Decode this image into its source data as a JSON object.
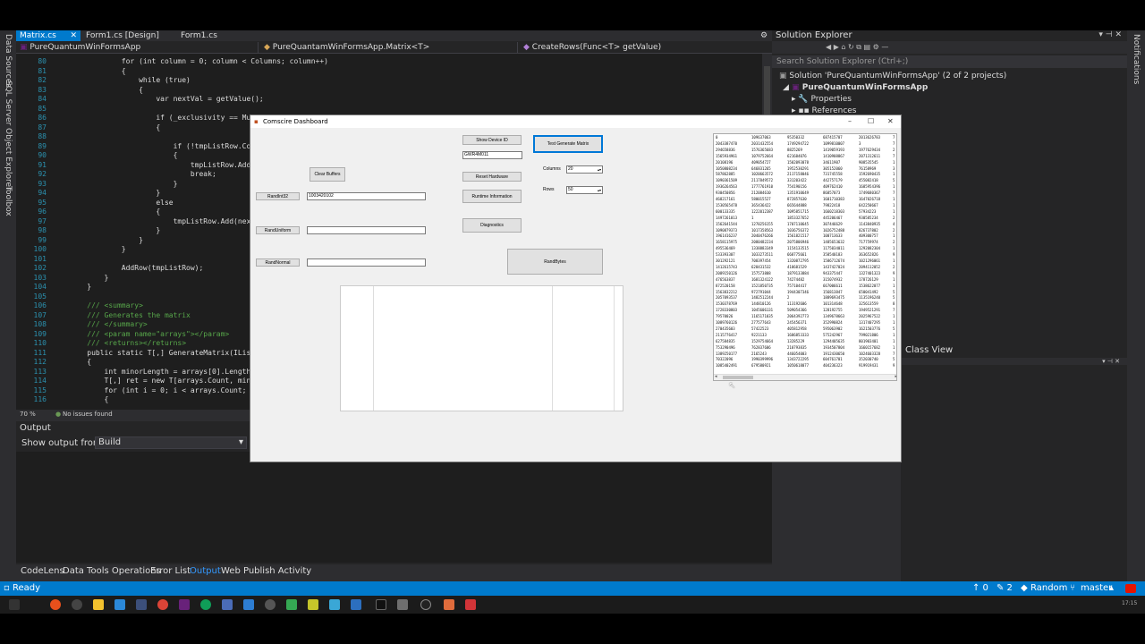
{
  "editor": {
    "tabs": [
      "Matrix.cs",
      "Form1.cs [Design]",
      "Form1.cs"
    ],
    "nav": {
      "project": "PureQuantumWinFormsApp",
      "class": "PureQuantamWinFormsApp.Matrix<T>",
      "member": "CreateRows(Func<T> getValue)"
    },
    "lines": [
      {
        "n": "80",
        "code": "            for (int column = 0; column < Columns; column++)"
      },
      {
        "n": "81",
        "code": "            {"
      },
      {
        "n": "82",
        "code": "                while (true)"
      },
      {
        "n": "83",
        "code": "                {"
      },
      {
        "n": "84",
        "code": "                    var nextVal = getValue();"
      },
      {
        "n": "85",
        "code": ""
      },
      {
        "n": "86",
        "code": "                    if (_exclusivity == Mutu"
      },
      {
        "n": "87",
        "code": "                    {"
      },
      {
        "n": "88",
        "code": ""
      },
      {
        "n": "89",
        "code": "                        if (!tmpListRow.Con"
      },
      {
        "n": "90",
        "code": "                        {"
      },
      {
        "n": "91",
        "code": "                            tmpListRow.Add("
      },
      {
        "n": "92",
        "code": "                            break;"
      },
      {
        "n": "93",
        "code": "                        }"
      },
      {
        "n": "94",
        "code": "                    }"
      },
      {
        "n": "95",
        "code": "                    else"
      },
      {
        "n": "96",
        "code": "                    {"
      },
      {
        "n": "97",
        "code": "                        tmpListRow.Add(next"
      },
      {
        "n": "98",
        "code": "                    }"
      },
      {
        "n": "99",
        "code": "                }"
      },
      {
        "n": "100",
        "code": "            }"
      },
      {
        "n": "101",
        "code": ""
      },
      {
        "n": "102",
        "code": "            AddRow(tmpListRow);"
      },
      {
        "n": "103",
        "code": "        }"
      },
      {
        "n": "104",
        "code": "    }"
      },
      {
        "n": "105",
        "code": ""
      },
      {
        "n": "106",
        "code": "    /// <summary>"
      },
      {
        "n": "107",
        "code": "    /// Generates the matrix"
      },
      {
        "n": "108",
        "code": "    /// </summary>"
      },
      {
        "n": "109",
        "code": "    /// <param name=\"arrays\"></param>"
      },
      {
        "n": "110",
        "code": "    /// <returns></returns>"
      },
      {
        "n": "111",
        "code": "    public static T[,] GenerateMatrix(IList"
      },
      {
        "n": "112",
        "code": "    {"
      },
      {
        "n": "113",
        "code": "        int minorLength = arrays[0].Length;"
      },
      {
        "n": "114",
        "code": "        T[,] ret = new T[arrays.Count, mino"
      },
      {
        "n": "115",
        "code": "        for (int i = 0; i < arrays.Count; i"
      },
      {
        "n": "116",
        "code": "        {"
      }
    ],
    "zoom": "70 %",
    "issues": "No issues found"
  },
  "left_strip": [
    "Data Sources",
    "SQL Server Object Explorer",
    "Toolbox"
  ],
  "right_strip": [
    "Notifications"
  ],
  "output": {
    "title": "Output",
    "from_label": "Show output from:",
    "from_value": "Build"
  },
  "bottom_tabs": [
    "CodeLens",
    "Data Tools Operations",
    "Error List",
    "Output",
    "Web Publish Activity"
  ],
  "solution_explorer": {
    "title": "Solution Explorer",
    "search_placeholder": "Search Solution Explorer (Ctrl+;)",
    "solution": "Solution 'PureQuantumWinFormsApp' (2 of 2 projects)",
    "project": "PureQuantumWinFormsApp",
    "properties": "Properties",
    "references": "References"
  },
  "class_view": {
    "title": "Class View"
  },
  "status": {
    "ready": "Ready",
    "up": "↑ 0",
    "pencil": "✎ 2",
    "branch_repo": "Random",
    "branch": "master",
    "time": "17:15"
  },
  "form": {
    "title": "Comscire Dashboard",
    "buttons": {
      "clear_buffers": "Clear Buffers",
      "randint32": "RandInt32",
      "rand_uniform": "RandUniform",
      "rand_normal": "RandNormal",
      "show_device_id": "Show Device ID",
      "reset_hardware": "Reset Hardware",
      "runtime_information": "Runtime Information",
      "diagnostics": "Diagnostics",
      "test_generate_matrix": "Test Generate Matrix",
      "rand_bytes": "RandBytes"
    },
    "fields": {
      "randint32_value": "1003420102",
      "device_id": "GWR4M011"
    },
    "columns_label": "Columns",
    "columns_value": "20",
    "rows_label": "Rows",
    "rows_value": "50",
    "grid_rows": [
      [
        "0",
        "109637063",
        "95350332",
        "687415707",
        "2013626783",
        "7"
      ],
      [
        "2043387470",
        "2031432554",
        "1749294722",
        "1099810007",
        "3",
        "7"
      ],
      [
        "294658836",
        "1576365683",
        "8825269",
        "1419059193",
        "1977629434",
        "2"
      ],
      [
        "1565934961",
        "1079752664",
        "621684076",
        "1410908867",
        "2071312611",
        "7"
      ],
      [
        "20108196",
        "409054727",
        "1502093078",
        "34611907",
        "908535545",
        "1"
      ],
      [
        "1050808234",
        "646831265",
        "1952530291",
        "305152060",
        "76158969",
        "3"
      ],
      [
        "587862885",
        "1020663572",
        "2117158046",
        "731745558",
        "1592690435",
        "1"
      ],
      [
        "1090361509",
        "2117849572",
        "331203422",
        "442757179",
        "455082418",
        "5"
      ],
      [
        "1936264563",
        "1777761910",
        "754190156",
        "409762410",
        "1685954396",
        "1"
      ],
      [
        "930450856",
        "212084610",
        "1351910649",
        "86857073",
        "1749680367",
        "7"
      ],
      [
        "468217161",
        "580015527",
        "872857630",
        "1601710383",
        "1647026718",
        "1"
      ],
      [
        "1530565478",
        "365436422",
        "665644888",
        "79822418",
        "642250667",
        "1"
      ],
      [
        "600133335",
        "1222012387",
        "1095851715",
        "1660218303",
        "57934223",
        "1"
      ],
      [
        "1497261013",
        "1",
        "1853327652",
        "445206467",
        "930585234",
        "2"
      ],
      [
        "1562641544",
        "1270256155",
        "1707110645",
        "307446629",
        "1143840935",
        "4"
      ],
      [
        "1090879373",
        "1017358563",
        "1036756372",
        "1026752488",
        "826737802",
        "2"
      ],
      [
        "1961416237",
        "2040476266",
        "1561821517",
        "100713633",
        "409300757",
        "1"
      ],
      [
        "1658115975",
        "2080482234",
        "2075806946",
        "1485653632",
        "717759974",
        "2"
      ],
      [
        "495536469",
        "1338883349",
        "1154133515",
        "1175034011",
        "1292082304",
        "1"
      ],
      [
        "533393307",
        "1033273511",
        "668775661",
        "358540183",
        "363652826",
        "9"
      ],
      [
        "301292121",
        "708397454",
        "1320872795",
        "1586712674",
        "1021296061",
        "1"
      ],
      [
        "1412615743",
        "628431532",
        "418681529",
        "1437427024",
        "2094112052",
        "2"
      ],
      [
        "2089150126",
        "157573808",
        "1879133884",
        "943375447",
        "1327401323",
        "9"
      ],
      [
        "476563837",
        "1681324122",
        "74274482",
        "315074932",
        "178726129",
        "1"
      ],
      [
        "872520158",
        "1521850735",
        "757104417",
        "667006611",
        "1538622077",
        "1"
      ],
      [
        "1563832212",
        "972791044",
        "1944307346",
        "156813847",
        "650041492",
        "5"
      ],
      [
        "2057093537",
        "1482512244",
        "2",
        "1889693475",
        "1135196240",
        "5"
      ],
      [
        "1530378769",
        "144810126",
        "113192606",
        "101314648",
        "325613559",
        "8"
      ],
      [
        "1728330803",
        "1045606131",
        "509054366",
        "128192755",
        "1949521291",
        "7"
      ],
      [
        "79570026",
        "1165171035",
        "2064392773",
        "1349678663",
        "2025967522",
        "1"
      ],
      [
        "1089760126",
        "277577643",
        "245456371",
        "352990824",
        "1317407295",
        "1"
      ],
      [
        "270435603",
        "57422523",
        "405812958",
        "595063902",
        "1621503776",
        "5"
      ],
      [
        "2115776417",
        "9221133",
        "1686853333",
        "575242967",
        "799021806",
        "1"
      ],
      [
        "627584835",
        "1529754664",
        "13285229",
        "1294405635",
        "801903401",
        "1"
      ],
      [
        "753290496",
        "762837606",
        "210793835",
        "1934507804",
        "1660157682",
        "1"
      ],
      [
        "1389250177",
        "2165243",
        "446054003",
        "1912430650",
        "1024603328",
        "7"
      ],
      [
        "70322096",
        "1990399996",
        "1343722295",
        "604761701",
        "352030740",
        "5"
      ],
      [
        "1085402491",
        "679580921",
        "1050618077",
        "404236323",
        "919919431",
        "9"
      ]
    ]
  }
}
